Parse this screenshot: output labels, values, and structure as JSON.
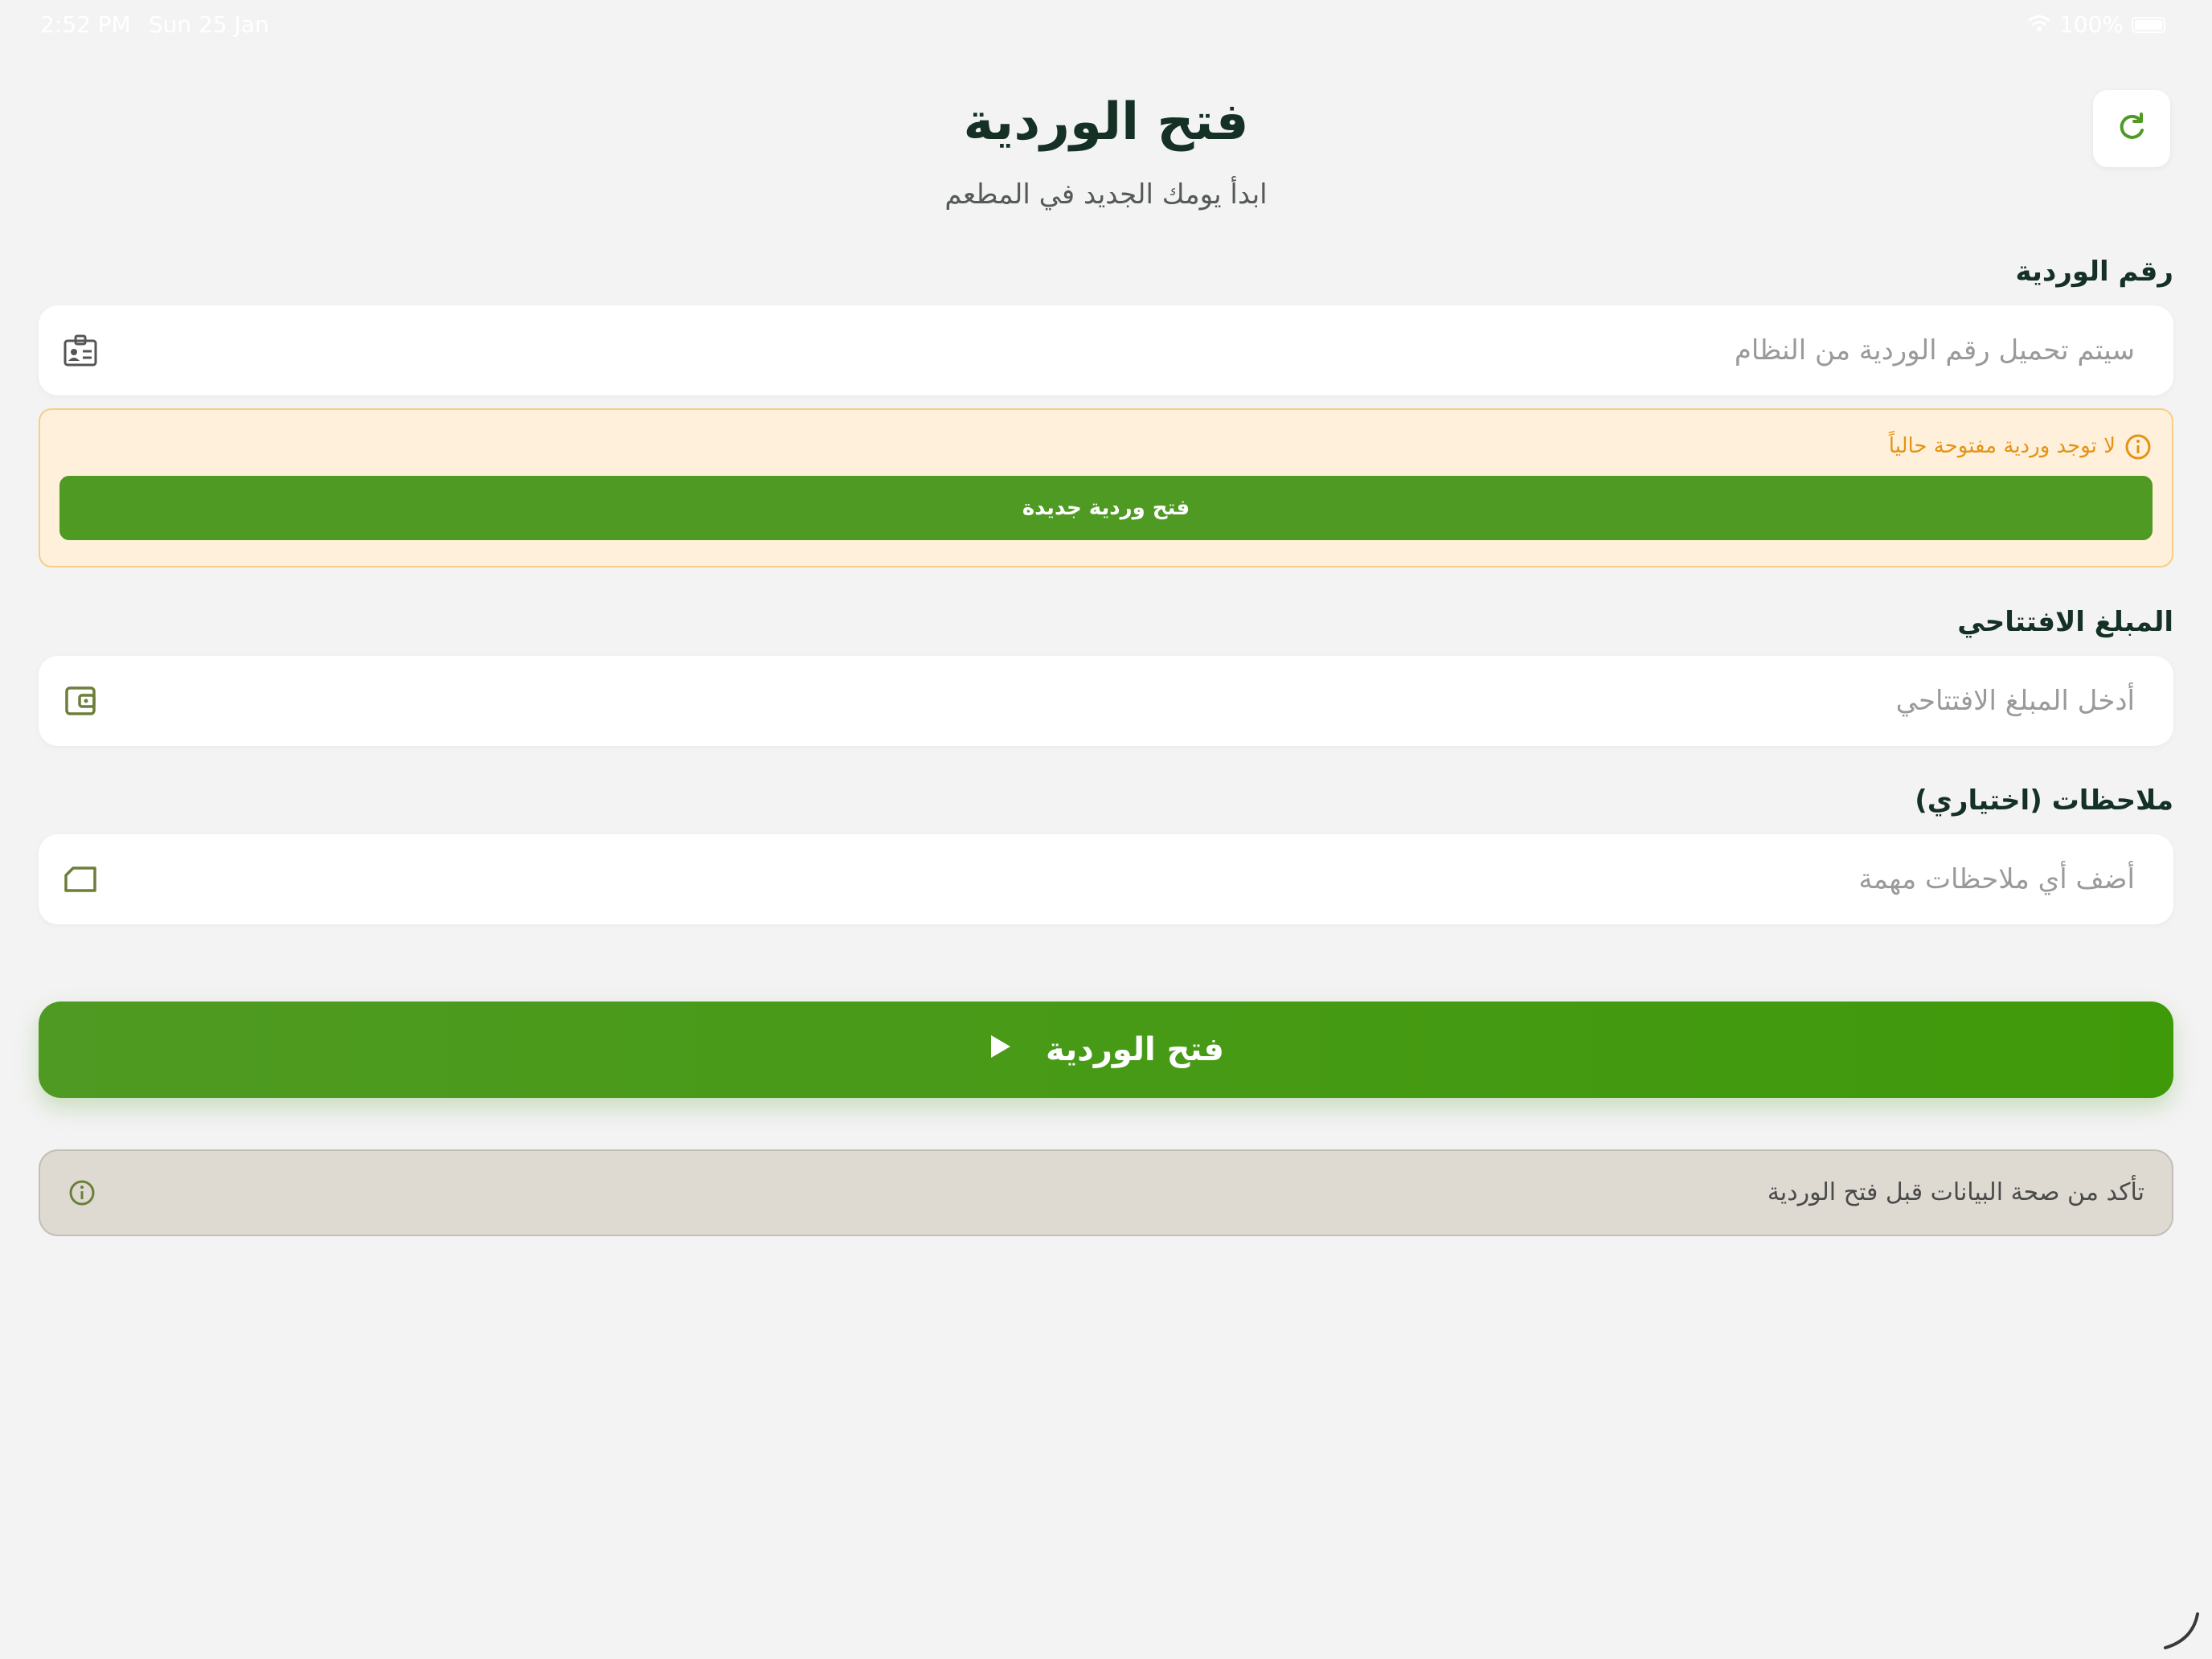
{
  "status_bar": {
    "time": "2:52 PM",
    "date": "Sun 25 Jan",
    "battery": "100%",
    "wifi_icon": "wifi-icon",
    "battery_icon": "battery-icon"
  },
  "header": {
    "title": "فتح الوردية",
    "subtitle": "ابدأ يومك الجديد في المطعم",
    "refresh_icon": "refresh-icon"
  },
  "shift_number": {
    "label": "رقم الوردية",
    "placeholder": "سيتم تحميل رقم الوردية من النظام",
    "icon": "id-card-icon"
  },
  "warning": {
    "text": "لا توجد وردية مفتوحة حالياً",
    "button_label": "فتح وردية جديدة",
    "icon": "info-icon"
  },
  "opening_amount": {
    "label": "المبلغ الافتتاحي",
    "placeholder": "أدخل المبلغ الافتتاحي",
    "icon": "wallet-icon"
  },
  "notes": {
    "label": "ملاحظات (اختياري)",
    "placeholder": "أضف أي ملاحظات مهمة",
    "icon": "note-icon"
  },
  "open_button": {
    "label": "فتح الوردية",
    "icon": "play-icon"
  },
  "info": {
    "text": "تأكد من صحة البيانات قبل فتح الوردية",
    "icon": "info-icon"
  },
  "colors": {
    "primary_green": "#4e9a22",
    "warning_orange": "#e49312",
    "title_dark": "#153126",
    "background": "#f3f3f3"
  }
}
